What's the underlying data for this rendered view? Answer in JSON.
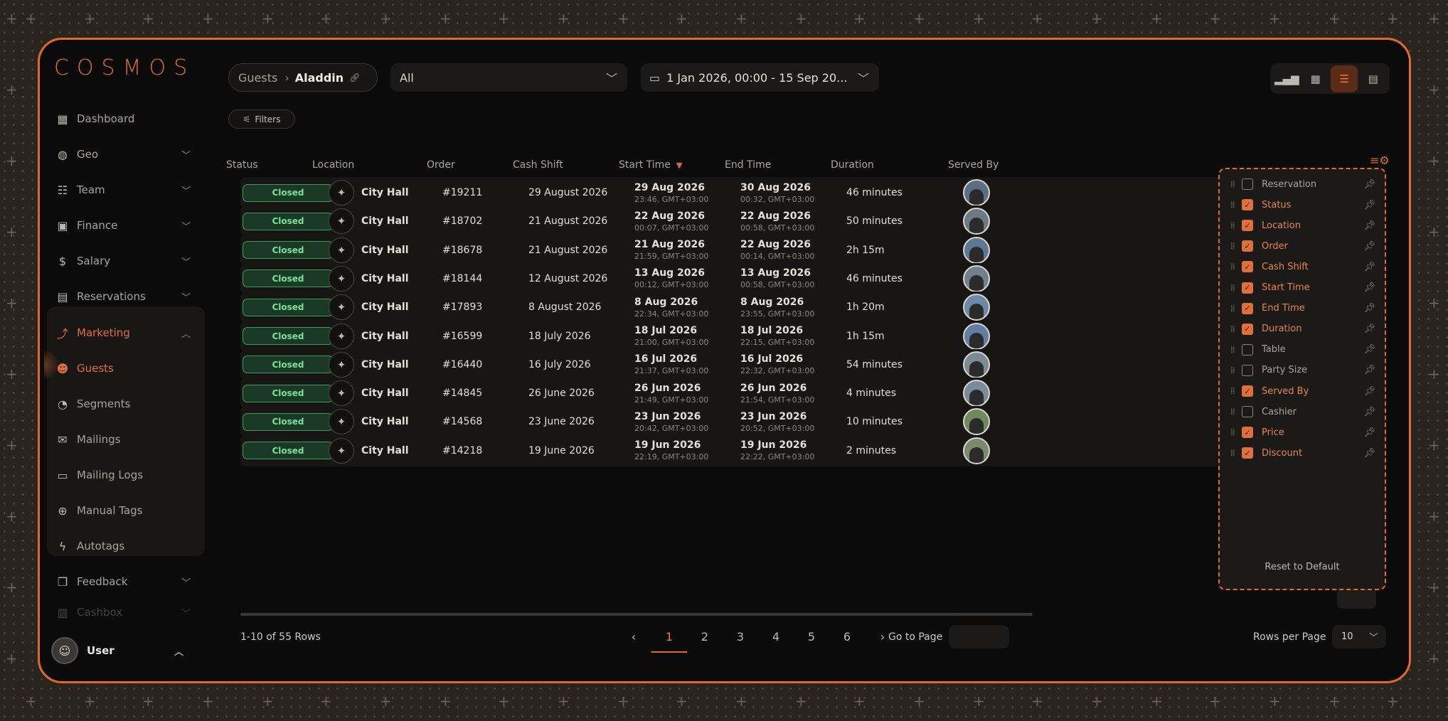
{
  "app": {
    "logo": "COSMOS"
  },
  "sidebar": {
    "items": [
      {
        "label": "Dashboard",
        "icon": "dashboard-icon",
        "glyph": "▦",
        "chevron": false
      },
      {
        "label": "Geo",
        "icon": "globe-icon",
        "glyph": "◍",
        "chevron": true
      },
      {
        "label": "Team",
        "icon": "team-icon",
        "glyph": "☷",
        "chevron": true
      },
      {
        "label": "Finance",
        "icon": "finance-icon",
        "glyph": "▣",
        "chevron": true
      },
      {
        "label": "Salary",
        "icon": "salary-icon",
        "glyph": "$",
        "chevron": true
      },
      {
        "label": "Reservations",
        "icon": "calendar-plus-icon",
        "glyph": "▤",
        "chevron": true
      },
      {
        "label": "Marketing",
        "icon": "marketing-icon",
        "glyph": "⤴",
        "chevron": true
      },
      {
        "label": "Guests",
        "icon": "guests-icon",
        "glyph": "☻",
        "chevron": false
      },
      {
        "label": "Segments",
        "icon": "pie-chart-icon",
        "glyph": "◔",
        "chevron": false
      },
      {
        "label": "Mailings",
        "icon": "mail-icon",
        "glyph": "✉",
        "chevron": false
      },
      {
        "label": "Mailing Logs",
        "icon": "chat-log-icon",
        "glyph": "▭",
        "chevron": false
      },
      {
        "label": "Manual Tags",
        "icon": "tag-add-icon",
        "glyph": "⊕",
        "chevron": false
      },
      {
        "label": "Autotags",
        "icon": "bolt-icon",
        "glyph": "ϟ",
        "chevron": false
      },
      {
        "label": "Feedback",
        "icon": "feedback-icon",
        "glyph": "❐",
        "chevron": true
      },
      {
        "label": "Cashbox",
        "icon": "cashbox-icon",
        "glyph": "▥",
        "chevron": true
      }
    ],
    "user": {
      "label": "User"
    }
  },
  "header": {
    "breadcrumb": {
      "parent": "Guests",
      "current": "Aladdin"
    },
    "filter_select": "All",
    "date_range": "1 Jan 2026, 00:00 - 15 Sep 20...",
    "filters_label": "Filters"
  },
  "table": {
    "columns": [
      "Status",
      "Location",
      "Order",
      "Cash Shift",
      "Start Time",
      "End Time",
      "Duration",
      "Served By"
    ],
    "rows": [
      {
        "status": "Closed",
        "location": "City Hall",
        "order": "#19211",
        "shift": "29 August 2026",
        "start": "29 Aug 2026",
        "start_sub": "23:46, GMT+03:00",
        "end": "30 Aug 2026",
        "end_sub": "00:32, GMT+03:00",
        "duration": "46 minutes"
      },
      {
        "status": "Closed",
        "location": "City Hall",
        "order": "#18702",
        "shift": "21 August 2026",
        "start": "22 Aug 2026",
        "start_sub": "00:07, GMT+03:00",
        "end": "22 Aug 2026",
        "end_sub": "00:58, GMT+03:00",
        "duration": "50 minutes"
      },
      {
        "status": "Closed",
        "location": "City Hall",
        "order": "#18678",
        "shift": "21 August 2026",
        "start": "21 Aug 2026",
        "start_sub": "21:59, GMT+03:00",
        "end": "22 Aug 2026",
        "end_sub": "00:14, GMT+03:00",
        "duration": "2h 15m"
      },
      {
        "status": "Closed",
        "location": "City Hall",
        "order": "#18144",
        "shift": "12 August 2026",
        "start": "13 Aug 2026",
        "start_sub": "00:12, GMT+03:00",
        "end": "13 Aug 2026",
        "end_sub": "00:58, GMT+03:00",
        "duration": "46 minutes"
      },
      {
        "status": "Closed",
        "location": "City Hall",
        "order": "#17893",
        "shift": "8 August 2026",
        "start": "8 Aug 2026",
        "start_sub": "22:34, GMT+03:00",
        "end": "8 Aug 2026",
        "end_sub": "23:55, GMT+03:00",
        "duration": "1h 20m"
      },
      {
        "status": "Closed",
        "location": "City Hall",
        "order": "#16599",
        "shift": "18 July 2026",
        "start": "18 Jul 2026",
        "start_sub": "21:00, GMT+03:00",
        "end": "18 Jul 2026",
        "end_sub": "22:15, GMT+03:00",
        "duration": "1h 15m"
      },
      {
        "status": "Closed",
        "location": "City Hall",
        "order": "#16440",
        "shift": "16 July 2026",
        "start": "16 Jul 2026",
        "start_sub": "21:37, GMT+03:00",
        "end": "16 Jul 2026",
        "end_sub": "22:32, GMT+03:00",
        "duration": "54 minutes"
      },
      {
        "status": "Closed",
        "location": "City Hall",
        "order": "#14845",
        "shift": "26 June 2026",
        "start": "26 Jun 2026",
        "start_sub": "21:49, GMT+03:00",
        "end": "26 Jun 2026",
        "end_sub": "21:54, GMT+03:00",
        "duration": "4 minutes"
      },
      {
        "status": "Closed",
        "location": "City Hall",
        "order": "#14568",
        "shift": "23 June 2026",
        "start": "23 Jun 2026",
        "start_sub": "20:42, GMT+03:00",
        "end": "23 Jun 2026",
        "end_sub": "20:52, GMT+03:00",
        "duration": "10 minutes"
      },
      {
        "status": "Closed",
        "location": "City Hall",
        "order": "#14218",
        "shift": "19 June 2026",
        "start": "19 Jun 2026",
        "start_sub": "22:19, GMT+03:00",
        "end": "19 Jun 2026",
        "end_sub": "22:22, GMT+03:00",
        "duration": "2 minutes"
      }
    ]
  },
  "column_panel": {
    "items": [
      {
        "label": "Reservation",
        "checked": false
      },
      {
        "label": "Status",
        "checked": true
      },
      {
        "label": "Location",
        "checked": true
      },
      {
        "label": "Order",
        "checked": true
      },
      {
        "label": "Cash Shift",
        "checked": true
      },
      {
        "label": "Start Time",
        "checked": true
      },
      {
        "label": "End Time",
        "checked": true
      },
      {
        "label": "Duration",
        "checked": true
      },
      {
        "label": "Table",
        "checked": false
      },
      {
        "label": "Party Size",
        "checked": false
      },
      {
        "label": "Served By",
        "checked": true
      },
      {
        "label": "Cashier",
        "checked": false
      },
      {
        "label": "Price",
        "checked": true
      },
      {
        "label": "Discount",
        "checked": true
      }
    ],
    "reset_label": "Reset to Default"
  },
  "footer": {
    "rows_info": "1-10 of 55 Rows",
    "pages": [
      "1",
      "2",
      "3",
      "4",
      "5",
      "6"
    ],
    "current_page": "1",
    "goto_label": "Go to Page",
    "rows_per_page_label": "Rows per Page",
    "rows_per_page": "10"
  },
  "colors": {
    "accent": "#e06a2a",
    "status_green": "#78e39a",
    "background": "#0b0b0b"
  }
}
